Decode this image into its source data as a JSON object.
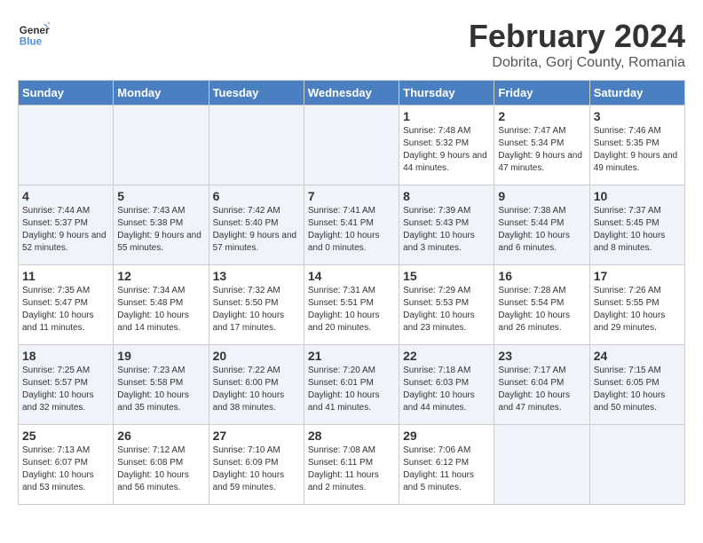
{
  "header": {
    "logo_general": "General",
    "logo_blue": "Blue",
    "title": "February 2024",
    "subtitle": "Dobrita, Gorj County, Romania"
  },
  "calendar": {
    "days_of_week": [
      "Sunday",
      "Monday",
      "Tuesday",
      "Wednesday",
      "Thursday",
      "Friday",
      "Saturday"
    ],
    "weeks": [
      [
        {
          "day": "",
          "info": ""
        },
        {
          "day": "",
          "info": ""
        },
        {
          "day": "",
          "info": ""
        },
        {
          "day": "",
          "info": ""
        },
        {
          "day": "1",
          "info": "Sunrise: 7:48 AM\nSunset: 5:32 PM\nDaylight: 9 hours and 44 minutes."
        },
        {
          "day": "2",
          "info": "Sunrise: 7:47 AM\nSunset: 5:34 PM\nDaylight: 9 hours and 47 minutes."
        },
        {
          "day": "3",
          "info": "Sunrise: 7:46 AM\nSunset: 5:35 PM\nDaylight: 9 hours and 49 minutes."
        }
      ],
      [
        {
          "day": "4",
          "info": "Sunrise: 7:44 AM\nSunset: 5:37 PM\nDaylight: 9 hours and 52 minutes."
        },
        {
          "day": "5",
          "info": "Sunrise: 7:43 AM\nSunset: 5:38 PM\nDaylight: 9 hours and 55 minutes."
        },
        {
          "day": "6",
          "info": "Sunrise: 7:42 AM\nSunset: 5:40 PM\nDaylight: 9 hours and 57 minutes."
        },
        {
          "day": "7",
          "info": "Sunrise: 7:41 AM\nSunset: 5:41 PM\nDaylight: 10 hours and 0 minutes."
        },
        {
          "day": "8",
          "info": "Sunrise: 7:39 AM\nSunset: 5:43 PM\nDaylight: 10 hours and 3 minutes."
        },
        {
          "day": "9",
          "info": "Sunrise: 7:38 AM\nSunset: 5:44 PM\nDaylight: 10 hours and 6 minutes."
        },
        {
          "day": "10",
          "info": "Sunrise: 7:37 AM\nSunset: 5:45 PM\nDaylight: 10 hours and 8 minutes."
        }
      ],
      [
        {
          "day": "11",
          "info": "Sunrise: 7:35 AM\nSunset: 5:47 PM\nDaylight: 10 hours and 11 minutes."
        },
        {
          "day": "12",
          "info": "Sunrise: 7:34 AM\nSunset: 5:48 PM\nDaylight: 10 hours and 14 minutes."
        },
        {
          "day": "13",
          "info": "Sunrise: 7:32 AM\nSunset: 5:50 PM\nDaylight: 10 hours and 17 minutes."
        },
        {
          "day": "14",
          "info": "Sunrise: 7:31 AM\nSunset: 5:51 PM\nDaylight: 10 hours and 20 minutes."
        },
        {
          "day": "15",
          "info": "Sunrise: 7:29 AM\nSunset: 5:53 PM\nDaylight: 10 hours and 23 minutes."
        },
        {
          "day": "16",
          "info": "Sunrise: 7:28 AM\nSunset: 5:54 PM\nDaylight: 10 hours and 26 minutes."
        },
        {
          "day": "17",
          "info": "Sunrise: 7:26 AM\nSunset: 5:55 PM\nDaylight: 10 hours and 29 minutes."
        }
      ],
      [
        {
          "day": "18",
          "info": "Sunrise: 7:25 AM\nSunset: 5:57 PM\nDaylight: 10 hours and 32 minutes."
        },
        {
          "day": "19",
          "info": "Sunrise: 7:23 AM\nSunset: 5:58 PM\nDaylight: 10 hours and 35 minutes."
        },
        {
          "day": "20",
          "info": "Sunrise: 7:22 AM\nSunset: 6:00 PM\nDaylight: 10 hours and 38 minutes."
        },
        {
          "day": "21",
          "info": "Sunrise: 7:20 AM\nSunset: 6:01 PM\nDaylight: 10 hours and 41 minutes."
        },
        {
          "day": "22",
          "info": "Sunrise: 7:18 AM\nSunset: 6:03 PM\nDaylight: 10 hours and 44 minutes."
        },
        {
          "day": "23",
          "info": "Sunrise: 7:17 AM\nSunset: 6:04 PM\nDaylight: 10 hours and 47 minutes."
        },
        {
          "day": "24",
          "info": "Sunrise: 7:15 AM\nSunset: 6:05 PM\nDaylight: 10 hours and 50 minutes."
        }
      ],
      [
        {
          "day": "25",
          "info": "Sunrise: 7:13 AM\nSunset: 6:07 PM\nDaylight: 10 hours and 53 minutes."
        },
        {
          "day": "26",
          "info": "Sunrise: 7:12 AM\nSunset: 6:08 PM\nDaylight: 10 hours and 56 minutes."
        },
        {
          "day": "27",
          "info": "Sunrise: 7:10 AM\nSunset: 6:09 PM\nDaylight: 10 hours and 59 minutes."
        },
        {
          "day": "28",
          "info": "Sunrise: 7:08 AM\nSunset: 6:11 PM\nDaylight: 11 hours and 2 minutes."
        },
        {
          "day": "29",
          "info": "Sunrise: 7:06 AM\nSunset: 6:12 PM\nDaylight: 11 hours and 5 minutes."
        },
        {
          "day": "",
          "info": ""
        },
        {
          "day": "",
          "info": ""
        }
      ]
    ]
  }
}
